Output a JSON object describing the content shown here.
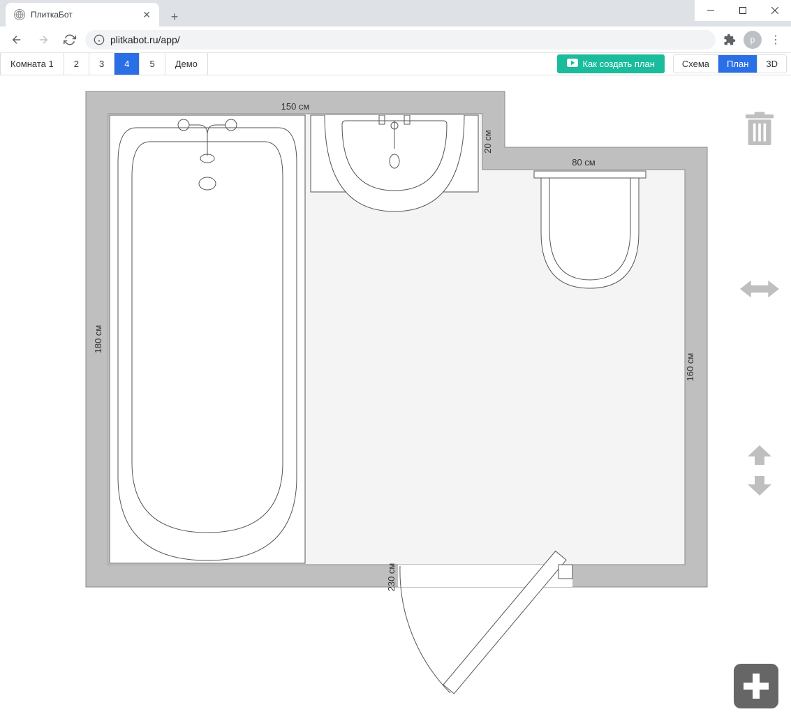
{
  "browser": {
    "tab_title": "ПлиткаБот",
    "url": "plitkabot.ru/app/",
    "avatar_letter": "p"
  },
  "toolbar": {
    "rooms": [
      "Комната 1",
      "2",
      "3",
      "4",
      "5",
      "Демо"
    ],
    "active_room_index": 3,
    "howto_label": "Как создать план",
    "views": [
      "Схема",
      "План",
      "3D"
    ],
    "active_view_index": 1
  },
  "floorplan": {
    "dims": {
      "top_width": "150 см",
      "left_height": "180 см",
      "notch_height": "20 см",
      "notch_top_width": "80 см",
      "right_height": "160 см",
      "bottom_width": "230 см"
    },
    "fixtures": [
      "bathtub",
      "sink",
      "toilet",
      "door"
    ]
  }
}
